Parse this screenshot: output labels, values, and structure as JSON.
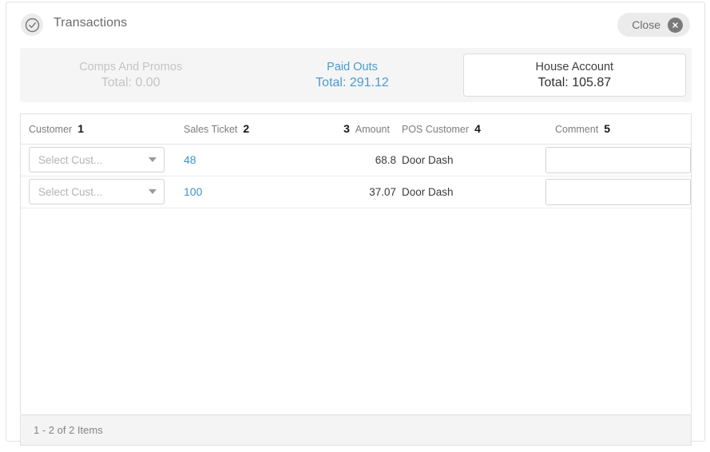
{
  "dialog": {
    "title": "Transactions",
    "status_icon": "check-circle-icon",
    "close": {
      "label": "Close",
      "icon": "close-circle-icon"
    }
  },
  "summary_tabs": [
    {
      "name": "Comps And Promos",
      "total": "Total: 0.00",
      "state": "disabled"
    },
    {
      "name": "Paid Outs",
      "total": "Total: 291.12",
      "state": "link"
    },
    {
      "name": "House Account",
      "total": "Total: 105.87",
      "state": "active"
    }
  ],
  "grid": {
    "columns": [
      {
        "label": "Customer",
        "marker": "1",
        "align": "left"
      },
      {
        "label": "Sales Ticket",
        "marker": "2",
        "align": "left"
      },
      {
        "label": "Amount",
        "marker": "3",
        "align": "right"
      },
      {
        "label": "POS Customer",
        "marker": "4",
        "align": "left"
      },
      {
        "label": "Comment",
        "marker": "5",
        "align": "left"
      }
    ],
    "rows": [
      {
        "customer_placeholder": "Select Cust...",
        "sales_ticket": "48",
        "amount": "68.8",
        "pos_customer": "Door Dash",
        "comment": ""
      },
      {
        "customer_placeholder": "Select Cust...",
        "sales_ticket": "100",
        "amount": "37.07",
        "pos_customer": "Door Dash",
        "comment": ""
      }
    ],
    "footer_text": "1 - 2 of 2 Items"
  },
  "colors": {
    "link_blue": "#3f93c9",
    "tab_blue": "#4a9bd1",
    "disabled_gray": "#c4c4c4",
    "panel_gray": "#f5f5f5"
  }
}
